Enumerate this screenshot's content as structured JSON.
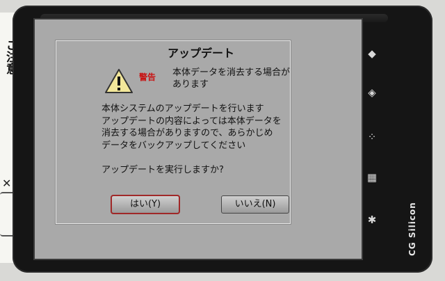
{
  "sticker": {
    "text": "ご注意",
    "mark": "✕"
  },
  "dialog": {
    "title": "アップデート",
    "warning_badge": "警告",
    "warning_message": "本体データを消去する場合が\nあります",
    "body_lines": [
      "本体システムのアップデートを行います",
      "アップデートの内容によっては本体データを",
      "消去する場合がありますので、あらかじめ",
      "データをバックアップしてください"
    ],
    "question": "アップデートを実行しますか?",
    "yes_label": "はい(Y)",
    "no_label": "いいえ(N)"
  },
  "side_keys": [
    {
      "icon": "diamond-arrow-icon",
      "glyph": "◆"
    },
    {
      "icon": "diamond-arrow-icon",
      "glyph": "◈"
    },
    {
      "icon": "dots-icon",
      "glyph": "⁘"
    },
    {
      "icon": "grid-icon",
      "glyph": "▦"
    },
    {
      "icon": "asterisk-icon",
      "glyph": "✱"
    }
  ],
  "brand": "CG Silicon",
  "colors": {
    "screen_bg": "#a9a9a9",
    "warning_red": "#c81414",
    "device_body": "#151515"
  }
}
